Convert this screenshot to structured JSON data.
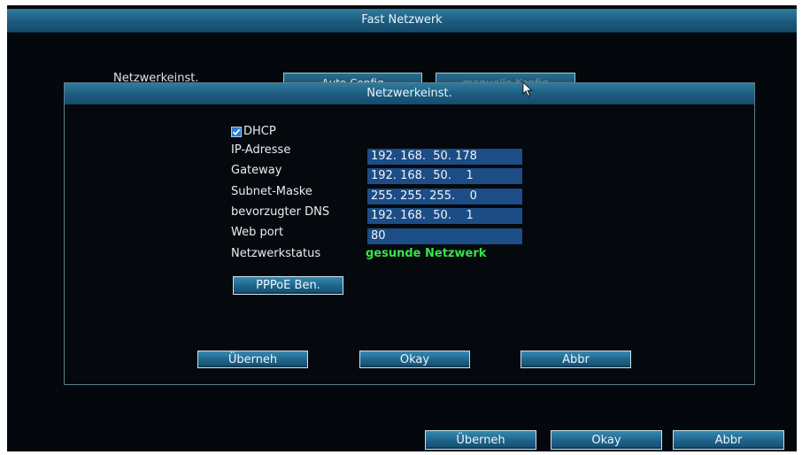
{
  "window": {
    "title": "Fast Netzwerk"
  },
  "outer": {
    "label": "Netzwerkeinst.",
    "auto_config": "Auto Config",
    "manual_config": "manuelle Konfig"
  },
  "dialog": {
    "title": "Netzwerkeinst.",
    "dhcp_label": "DHCP",
    "dhcp_checked": true,
    "fields": {
      "ip_label": "IP-Adresse",
      "ip_value": "192. 168.  50. 178",
      "gateway_label": "Gateway",
      "gateway_value": "192. 168.  50.    1",
      "subnet_label": "Subnet-Maske",
      "subnet_value": "255. 255. 255.    0",
      "dns_label": "bevorzugter DNS",
      "dns_value": "192. 168.  50.    1",
      "webport_label": "Web port",
      "webport_value": "80",
      "status_label": "Netzwerkstatus",
      "status_value": "gesunde Netzwerk"
    },
    "pppoe_button": "PPPoE Ben.",
    "apply_button": "Überneh",
    "ok_button": "Okay",
    "cancel_button": "Abbr"
  },
  "footer": {
    "apply_button": "Überneh",
    "ok_button": "Okay",
    "cancel_button": "Abbr"
  },
  "colors": {
    "titlebar": "#1c5b7e",
    "field_bg": "#1c4d86",
    "status_ok": "#37e34b",
    "checkbox": "#2e7bd3"
  }
}
